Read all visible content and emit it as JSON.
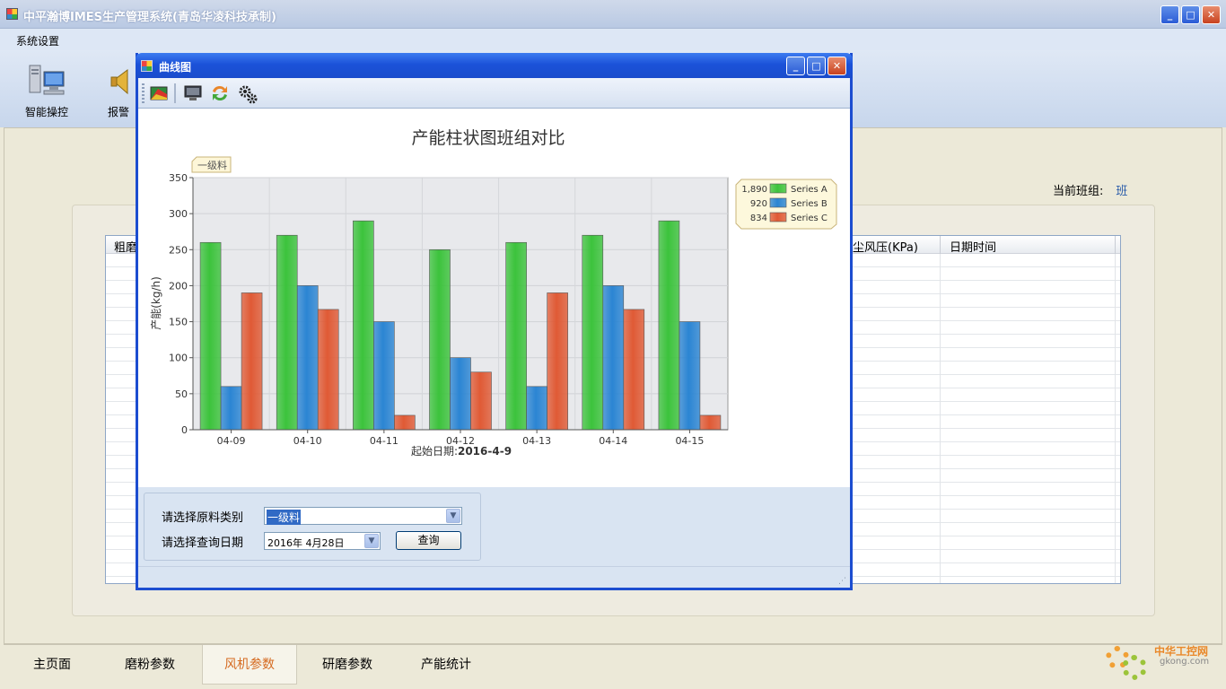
{
  "app": {
    "title": "中平瀚博IMES生产管理系统(青岛华凌科技承制)"
  },
  "menu": {
    "items": [
      "系统设置"
    ]
  },
  "toolstrip": {
    "items": [
      {
        "label": "智能操控",
        "icon": "computer-network-icon"
      },
      {
        "label": "报警",
        "icon": "alarm-horn-icon"
      }
    ]
  },
  "main": {
    "current_team_label": "当前班组:",
    "current_team_value": "班",
    "grid_headers": [
      "粗磨",
      "尘风压(KPa)",
      "日期时间"
    ]
  },
  "tabs": [
    {
      "label": "主页面",
      "active": false
    },
    {
      "label": "磨粉参数",
      "active": false
    },
    {
      "label": "风机参数",
      "active": true
    },
    {
      "label": "研磨参数",
      "active": false
    },
    {
      "label": "产能统计",
      "active": false
    }
  ],
  "watermark": {
    "line1": "中华工控网",
    "line2": "gkong.com"
  },
  "dialog": {
    "title": "曲线图",
    "toolbar_icons": [
      "chart-palette-icon",
      "monitor-icon",
      "refresh-arrows-icon",
      "settings-gears-icon"
    ],
    "form": {
      "material_label": "请选择原料类别",
      "material_value": "一级料",
      "date_label": "请选择查询日期",
      "date_value": "2016年 4月28日",
      "query_button": "查询"
    }
  },
  "colors": {
    "series_a": "#3cc33c",
    "series_b": "#2b85d3",
    "series_c": "#e05a35",
    "title_blue": "#1b52d9"
  },
  "chart_data": {
    "type": "bar",
    "title": "产能柱状图班组对比",
    "tag": "一级料",
    "ylabel": "产能(kg/h)",
    "xlabel_prefix": "起始日期:",
    "xlabel_value": "2016-4-9",
    "ylim": [
      0,
      350
    ],
    "yticks": [
      0,
      50,
      100,
      150,
      200,
      250,
      300,
      350
    ],
    "categories": [
      "04-09",
      "04-10",
      "04-11",
      "04-12",
      "04-13",
      "04-14",
      "04-15"
    ],
    "series": [
      {
        "name": "Series A",
        "total": "1,890",
        "values": [
          260,
          270,
          290,
          250,
          260,
          270,
          290
        ]
      },
      {
        "name": "Series B",
        "total": "920",
        "values": [
          60,
          200,
          150,
          100,
          60,
          200,
          150
        ]
      },
      {
        "name": "Series C",
        "total": "834",
        "values": [
          190,
          167,
          20,
          80,
          190,
          167,
          20
        ]
      }
    ],
    "grid": true,
    "legend_position": "right"
  }
}
